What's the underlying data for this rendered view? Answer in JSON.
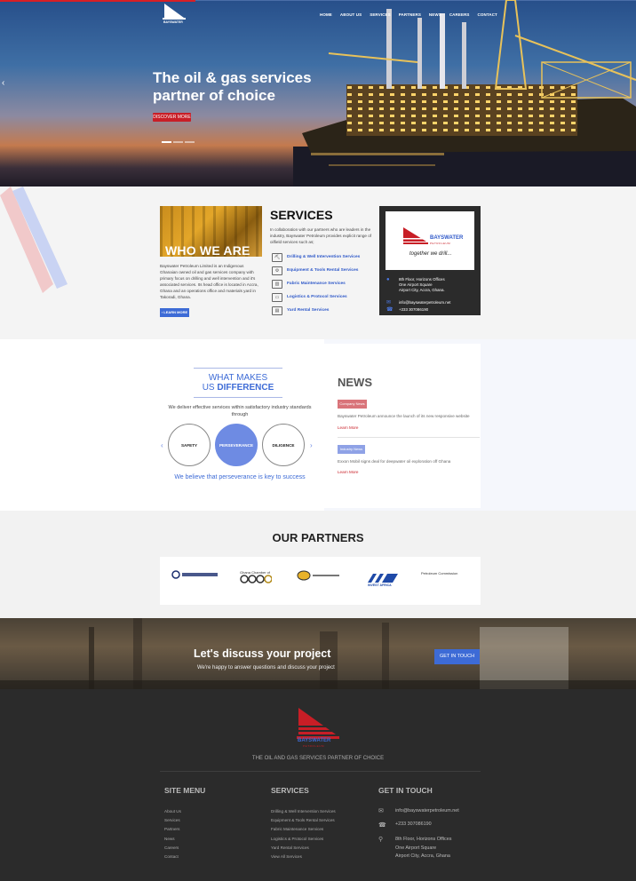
{
  "brand": {
    "name": "BAYSWATER",
    "sub": "PETROLEUM",
    "tagline": "together we drill..."
  },
  "nav": [
    "HOME",
    "ABOUT US",
    "SERVICES",
    "PARTNERS",
    "NEWS",
    "CAREERS",
    "CONTACT"
  ],
  "hero": {
    "title": "The oil & gas services partner of choice",
    "button": "DISCOVER MORE",
    "arrow": "‹"
  },
  "about": {
    "heading": "WHO WE ARE",
    "text": "Bayswater Petroleum Limited is an Indigenous Ghanaian owned oil and gas services company with primary focus on drilling and well intervention and it's associated services. Its head office is located in Accra, Ghana and an operations office and materials yard in Takoradi, Ghana.",
    "button": "› LEARN MORE"
  },
  "services": {
    "heading": "SERVICES",
    "intro": "In collaboration with our partners who are leaders in the industry, Bayswater Petroleum provides explicit range of oilfield services such as;",
    "items": [
      {
        "label": "Drilling & Well Intervention Services",
        "icon": "drill-icon"
      },
      {
        "label": "Equipment & Tools Rental Services",
        "icon": "tools-icon"
      },
      {
        "label": "Fabric Maintenance Services",
        "icon": "factory-icon"
      },
      {
        "label": "Logistics & Protocol Services",
        "icon": "truck-icon"
      },
      {
        "label": "Yard Rental Services",
        "icon": "yard-icon"
      }
    ]
  },
  "contact_card": {
    "address": [
      "8th Floor, Horizons Offices",
      "One Airport Square",
      "Airport City, Accra, Ghana."
    ],
    "email": "info@bayswaterpetroleum.net",
    "phone": "+233 307086190"
  },
  "difference": {
    "title_line1": "WHAT MAKES",
    "title_pre": "US ",
    "title_bold": "DIFFERENCE",
    "text": "We deliver effective services within satisfactory industry standards through",
    "values": [
      "SAFETY",
      "PERSEVERANCE",
      "DILIGENCE"
    ],
    "footer": "We believe that perseverance is key to success",
    "prev": "‹",
    "next": "›"
  },
  "news": {
    "heading": "NEWS",
    "items": [
      {
        "tag": "Company News",
        "text": "Bayswater Petroleum announce the launch of its new responsive website",
        "more": "Learn More",
        "tag_color": "#d9747a"
      },
      {
        "tag": "Industry News",
        "text": "Exxon Mobil signs deal for deepwater oil exploration off Ghana",
        "more": "Learn More",
        "tag_color": "#8fa2e6"
      }
    ]
  },
  "partners": {
    "heading": "OUR PARTNERS",
    "logos": [
      {
        "name": "bank-logo",
        "text": "Bank"
      },
      {
        "name": "ghana-chamber-logo",
        "text": "Ghana Chamber of"
      },
      {
        "name": "oil-company-logo",
        "text": ""
      },
      {
        "name": "invest-africa-logo",
        "text": "INVEST AFRICA"
      },
      {
        "name": "petroleum-commission-logo",
        "text": "Petroleum Commission"
      }
    ]
  },
  "cta": {
    "title": "Let's discuss your project",
    "subtitle": "We're happy to answer questions and discuss your project",
    "button": "GET IN TOUCH"
  },
  "footer": {
    "tagline": "THE OIL AND GAS SERVICES PARTNER OF CHOICE",
    "site_menu": {
      "title": "SITE MENU",
      "items": [
        "About Us",
        "Services",
        "Partners",
        "News",
        "Careers",
        "Contact"
      ]
    },
    "services": {
      "title": "SERVICES",
      "items": [
        "Drilling & Well Intervention Services",
        "Equipment & Tools Rental Services",
        "Fabric Maintenance Services",
        "Logistics & Protocol Services",
        "Yard Rental Services",
        "View All Services"
      ]
    },
    "contact": {
      "title": "GET IN TOUCH",
      "email": "info@bayswaterpetroleum.net",
      "phone": "+233 307086190",
      "address": [
        "8th Floor, Horizons Offices",
        "One Airport Square",
        "Airport City, Accra, Ghana"
      ]
    }
  },
  "colors": {
    "accent": "#3d6bd6",
    "brand_red": "#c81e26",
    "footer_bg": "#2b2b2b"
  }
}
